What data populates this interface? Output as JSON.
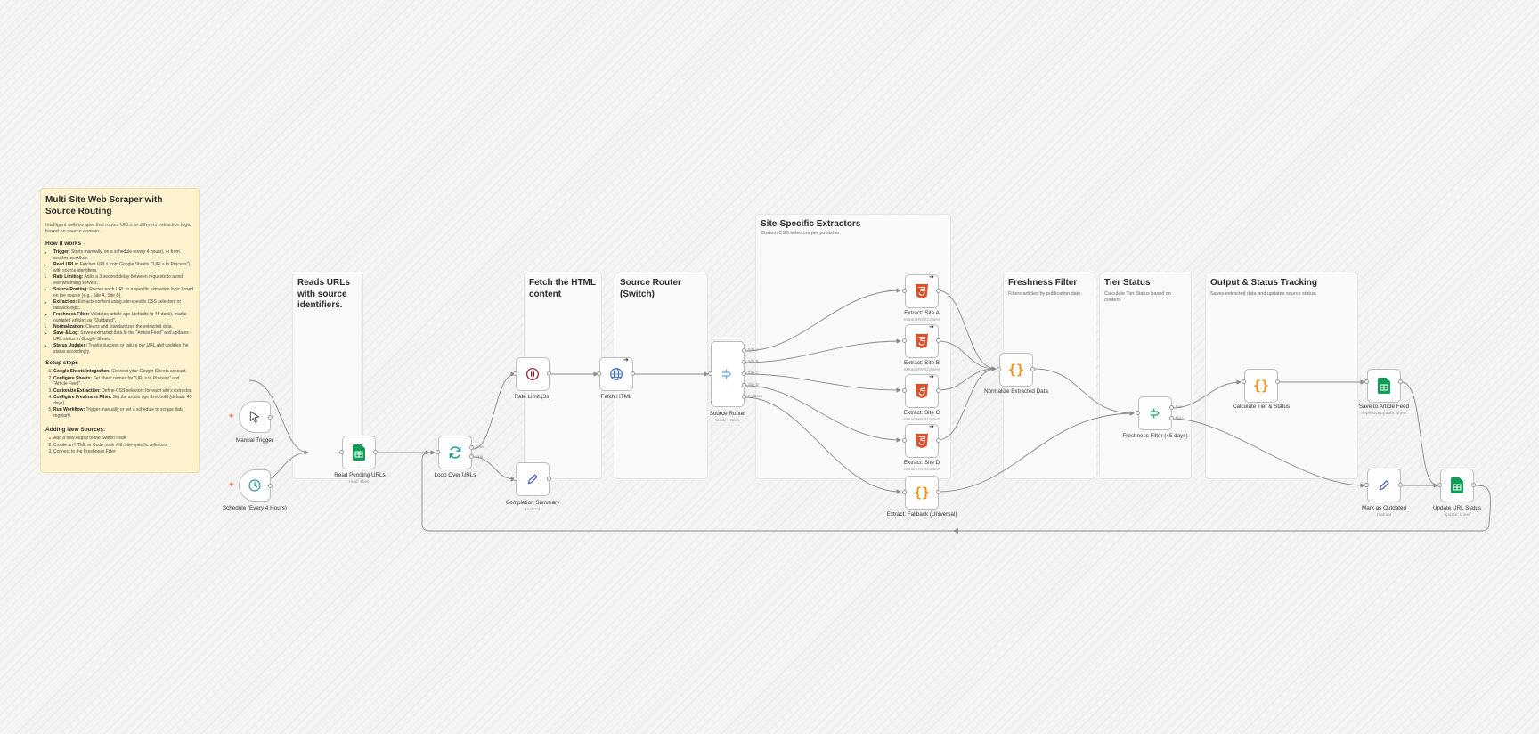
{
  "note": {
    "title": "Multi-Site Web Scraper with Source Routing",
    "intro": "Intelligent web scraper that routes URLs to different extraction logic based on source domain.",
    "how_heading": "How it works",
    "how": [
      {
        "b": "Trigger:",
        "t": " Starts manually, on a schedule (every 4 hours), or from another workflow."
      },
      {
        "b": "Read URLs:",
        "t": " Fetches URLs from Google Sheets (\"URLs to Process\") with source identifiers."
      },
      {
        "b": "Rate Limiting:",
        "t": " Adds a 3-second delay between requests to avoid overwhelming servers."
      },
      {
        "b": "Source Routing:",
        "t": " Routes each URL to a specific extraction logic based on the source (e.g., Site A, Site B)."
      },
      {
        "b": "Extraction:",
        "t": " Extracts content using site-specific CSS selectors or fallback logic."
      },
      {
        "b": "Freshness Filter:",
        "t": " Validates article age (defaults to 45 days), marks outdated articles as \"Outdated\"."
      },
      {
        "b": "Normalization:",
        "t": " Cleans and standardizes the extracted data."
      },
      {
        "b": "Save & Log:",
        "t": " Saves extracted data to the \"Article Feed\" and updates URL status in Google Sheets."
      },
      {
        "b": "Status Updates:",
        "t": " Tracks success or failure per URL and updates the status accordingly."
      }
    ],
    "setup_heading": "Setup steps",
    "setup": [
      {
        "b": "Google Sheets Integration:",
        "t": " Connect your Google Sheets account."
      },
      {
        "b": "Configure Sheets:",
        "t": " Set sheet names for \"URLs to Process\" and \"Article Feed\"."
      },
      {
        "b": "Customize Extraction:",
        "t": " Define CSS selectors for each site's extractor."
      },
      {
        "b": "Configure Freshness Filter:",
        "t": " Set the article age threshold (default: 45 days)."
      },
      {
        "b": "Run Workflow:",
        "t": " Trigger manually or set a schedule to scrape data regularly."
      }
    ],
    "adding_heading": "Adding New Sources:",
    "adding": [
      {
        "b": "",
        "t": "Add a new output to the Switch node"
      },
      {
        "b": "",
        "t": "Create an HTML or Code node with site-specific selectors"
      },
      {
        "b": "",
        "t": "Connect to the Freshness Filter"
      }
    ]
  },
  "groups": {
    "reads": {
      "title": "Reads URLs with source identifiers.",
      "subtitle": ""
    },
    "fetch": {
      "title": "Fetch the HTML content",
      "subtitle": ""
    },
    "router": {
      "title": "Source Router (Switch)",
      "subtitle": ""
    },
    "extractors": {
      "title": "Site-Specific Extractors",
      "subtitle": "Custom CSS selectors per publisher."
    },
    "fresh": {
      "title": "Freshness Filter",
      "subtitle": "Filters articles by publication date."
    },
    "tier": {
      "title": "Tier Status",
      "subtitle": "Calculate Tier Status based on content"
    },
    "output": {
      "title": "Output & Status Tracking",
      "subtitle": "Saves extracted data and updates source status."
    }
  },
  "nodes": {
    "manual": {
      "label": "Manual Trigger",
      "sub": "",
      "icon": "cursor-icon"
    },
    "schedule": {
      "label": "Schedule (Every 4 Hours)",
      "sub": "",
      "icon": "clock-icon"
    },
    "read": {
      "label": "Read Pending URLs",
      "sub": "read: sheet",
      "icon": "google-sheets-icon"
    },
    "loop": {
      "label": "Loop Over URLs",
      "sub": "",
      "icon": "loop-icon"
    },
    "rate": {
      "label": "Rate Limit (3s)",
      "sub": "",
      "icon": "pause-icon"
    },
    "summary": {
      "label": "Completion Summary",
      "sub": "manual",
      "icon": "pencil-icon"
    },
    "fetch": {
      "label": "Fetch HTML",
      "sub": "",
      "icon": "globe-icon"
    },
    "router": {
      "label": "Source Router",
      "sub": "mode: Rules",
      "icon": "switch-icon"
    },
    "exA": {
      "label": "Extract: Site A",
      "sub": "extractHtmlContent",
      "icon": "html5-icon"
    },
    "exB": {
      "label": "Extract: Site B",
      "sub": "extractHtmlContent",
      "icon": "html5-icon"
    },
    "exC": {
      "label": "Extract: Site C",
      "sub": "extractHtmlContent",
      "icon": "html5-icon"
    },
    "exD": {
      "label": "Extract: Site D",
      "sub": "extractHtmlContent",
      "icon": "html5-icon"
    },
    "exF": {
      "label": "Extract: Fallback (Universal)",
      "sub": "",
      "icon": "code-braces-icon"
    },
    "normalize": {
      "label": "Normalize Extracted Data",
      "sub": "",
      "icon": "code-braces-icon"
    },
    "freshness": {
      "label": "Freshness Filter (45 days)",
      "sub": "",
      "icon": "filter-icon"
    },
    "tier": {
      "label": "Calculate Tier & Status",
      "sub": "",
      "icon": "code-braces-icon"
    },
    "save": {
      "label": "Save to Article Feed",
      "sub": "appendOrUpdate: sheet",
      "icon": "google-sheets-icon"
    },
    "outdated": {
      "label": "Mark as Outdated",
      "sub": "manual",
      "icon": "pencil-icon"
    },
    "update": {
      "label": "Update URL Status",
      "sub": "update: sheet",
      "icon": "google-sheets-icon"
    }
  },
  "ports": {
    "loop_done": "done",
    "loop_loop": "loop",
    "r_a": "Site A",
    "r_b": "Site B",
    "r_c": "Site C",
    "r_d": "Site D",
    "r_f": "Fallback",
    "f_true": "true",
    "f_false": "false"
  },
  "colors": {
    "sticky_yellow": "#fff3cf",
    "trigger_bolt": "#ff6d5a",
    "sheets_green": "#0f9d58",
    "html5_orange": "#e44d26",
    "code_orange": "#f29111",
    "rate_maroon": "#8b1a2b",
    "globe_blue": "#2d5fb5",
    "switch_blue": "#5aa6e8",
    "filter_green": "#2e9b5b",
    "pencil_blue": "#4a57c4",
    "schedule_teal": "#1e9e8e"
  }
}
